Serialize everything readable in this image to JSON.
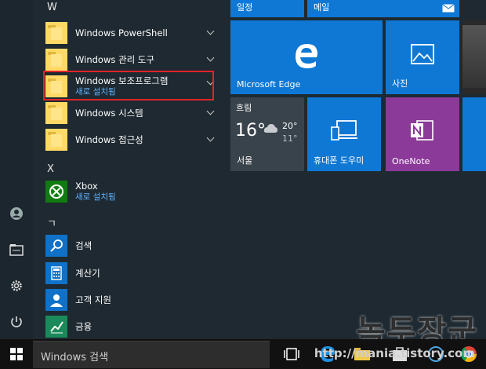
{
  "list": {
    "section_w": "W",
    "section_x": "X",
    "section_g": "ㄱ",
    "items": [
      {
        "label": "Windows PowerShell"
      },
      {
        "label": "Windows 관리 도구"
      },
      {
        "label": "Windows 보조프로그램",
        "sub": "새로 설치됨"
      },
      {
        "label": "Windows 시스템"
      },
      {
        "label": "Windows 접근성"
      },
      {
        "label": "Xbox",
        "sub": "새로 설치됨"
      },
      {
        "label": "검색"
      },
      {
        "label": "계산기"
      },
      {
        "label": "고객 지원"
      },
      {
        "label": "금융"
      }
    ]
  },
  "tiles": {
    "calendar": "일정",
    "mail": "메일",
    "edge": "Microsoft Edge",
    "photos": "사진",
    "weather": {
      "condition": "흐림",
      "temp": "16°",
      "high": "20°",
      "low": "11°",
      "city": "서울"
    },
    "phone": "휴대폰 도우미",
    "onenote": "OneNote"
  },
  "taskbar": {
    "search_placeholder": "Windows 검색"
  },
  "watermark": {
    "brand": "녹두장군",
    "url": "http://mania.tistory.com"
  },
  "colors": {
    "tile_blue": "#0f78d4",
    "onenote_purple": "#8b3a99",
    "highlight_red": "#e0242b",
    "new_install_blue": "#5fb3ff"
  }
}
